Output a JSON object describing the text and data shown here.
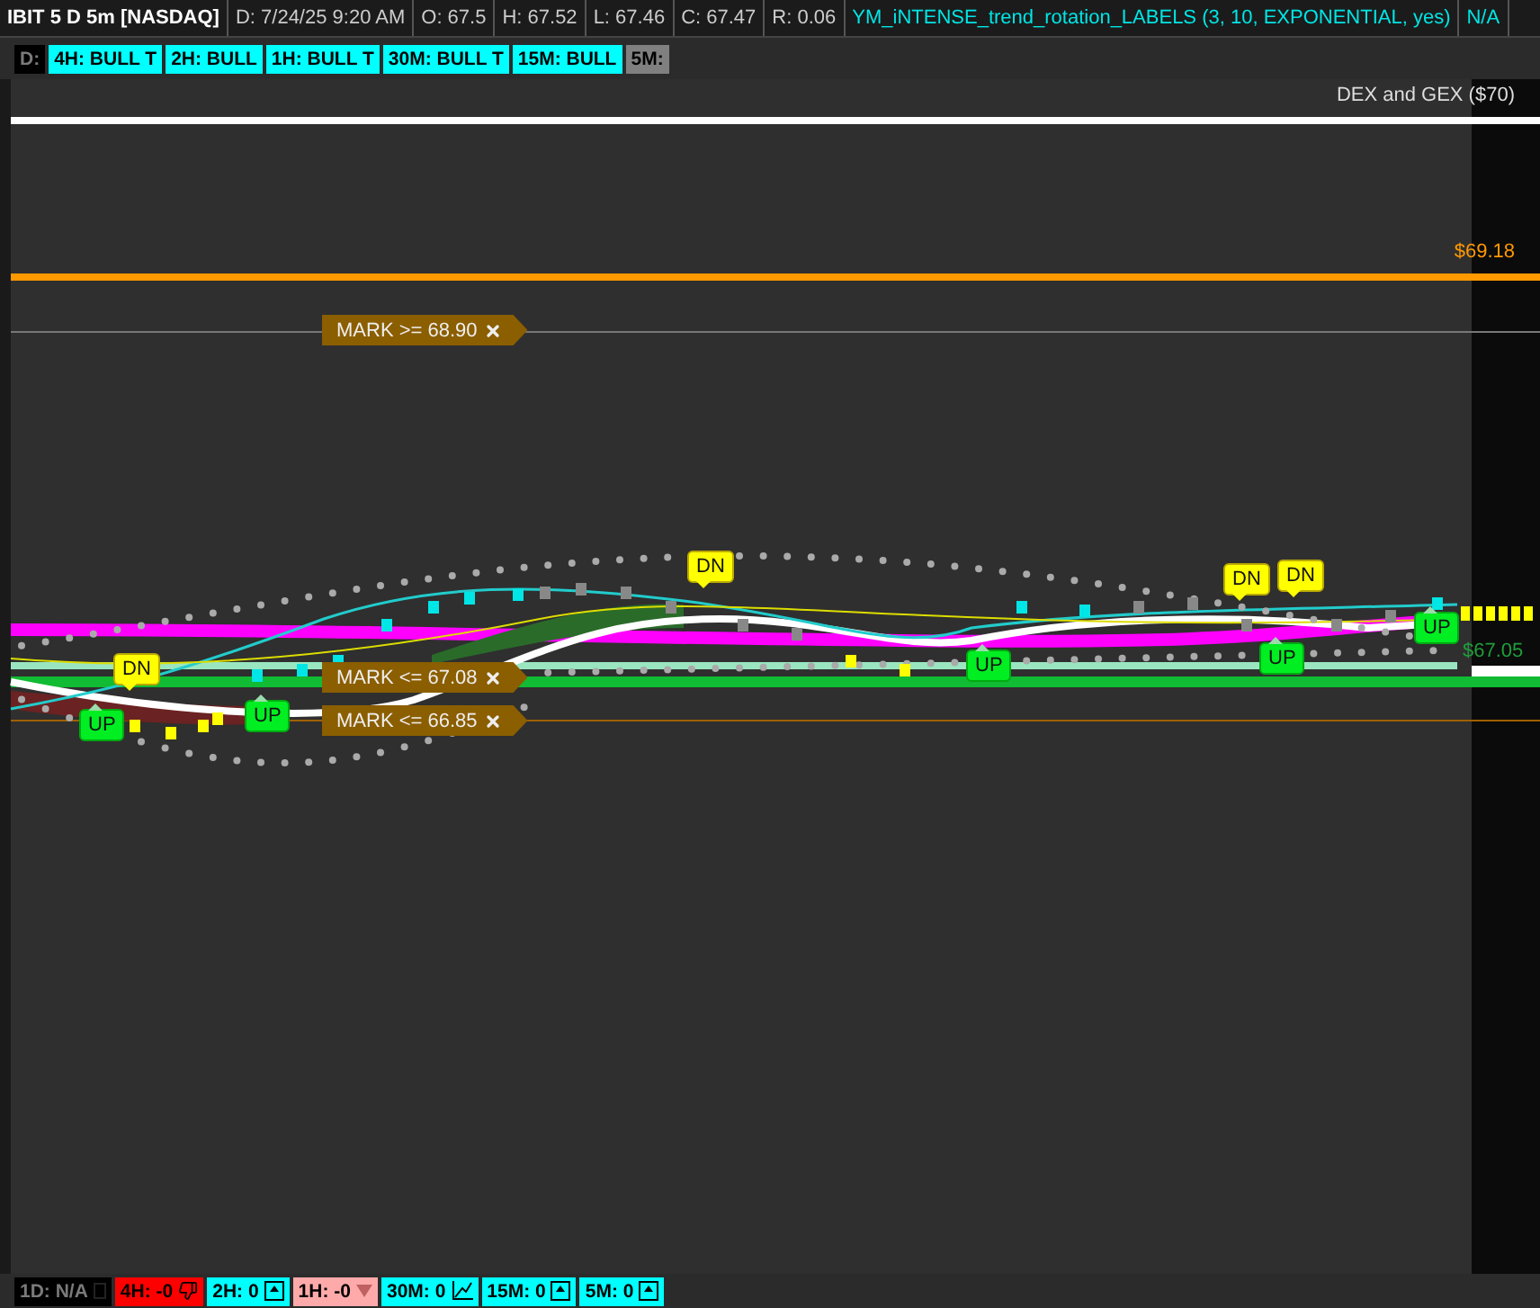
{
  "header": {
    "symbol": "IBIT 5 D 5m [NASDAQ]",
    "fields": [
      "D: 7/24/25 9:20 AM",
      "O: 67.5",
      "H: 67.52",
      "L: 67.46",
      "C: 67.47",
      "R: 0.06"
    ],
    "study": "YM_iNTENSE_trend_rotation_LABELS (3, 10, EXPONENTIAL, yes)",
    "study_value": "N/A"
  },
  "top_labels": [
    {
      "text": "D:",
      "color": "#000000"
    },
    {
      "text": "4H: BULL T",
      "color": "#00ffff"
    },
    {
      "text": "2H: BULL",
      "color": "#00ffff"
    },
    {
      "text": "1H: BULL T",
      "color": "#00ffff"
    },
    {
      "text": "30M: BULL T",
      "color": "#00ffff"
    },
    {
      "text": "15M: BULL",
      "color": "#00ffff"
    },
    {
      "text": "5M:",
      "color": "#808080"
    }
  ],
  "study_title": "DEX and GEX ($70)",
  "price_labels": [
    {
      "text": "$69.18",
      "color": "#ff9900"
    },
    {
      "text": "$67.05",
      "color": "#1f9e3a"
    }
  ],
  "marks": [
    "MARK >= 68.90",
    "MARK <= 67.08",
    "MARK <= 66.85"
  ],
  "signals": [
    {
      "kind": "dn",
      "text": "DN"
    },
    {
      "kind": "up",
      "text": "UP"
    },
    {
      "kind": "up",
      "text": "UP"
    },
    {
      "kind": "dn",
      "text": "DN"
    },
    {
      "kind": "up",
      "text": "UP"
    },
    {
      "kind": "dn",
      "text": "DN"
    },
    {
      "kind": "dn",
      "text": "DN"
    },
    {
      "kind": "up",
      "text": "UP"
    },
    {
      "kind": "up",
      "text": "UP"
    }
  ],
  "bottom_labels": [
    {
      "text": "1D: N/A",
      "color": "#000000",
      "kind": "square"
    },
    {
      "text": "4H: -0",
      "color": "#ff0000",
      "kind": "thumbs-down"
    },
    {
      "text": "2H: 0",
      "color": "#00ffff",
      "kind": "up-box"
    },
    {
      "text": "1H: -0",
      "color": "#ffaaaa",
      "kind": "triangle-down"
    },
    {
      "text": "30M: 0",
      "color": "#00ffff",
      "kind": "trend"
    },
    {
      "text": "15M: 0",
      "color": "#00ffff",
      "kind": "up-box"
    },
    {
      "text": "5M: 0",
      "color": "#00ffff",
      "kind": "up-box"
    }
  ]
}
